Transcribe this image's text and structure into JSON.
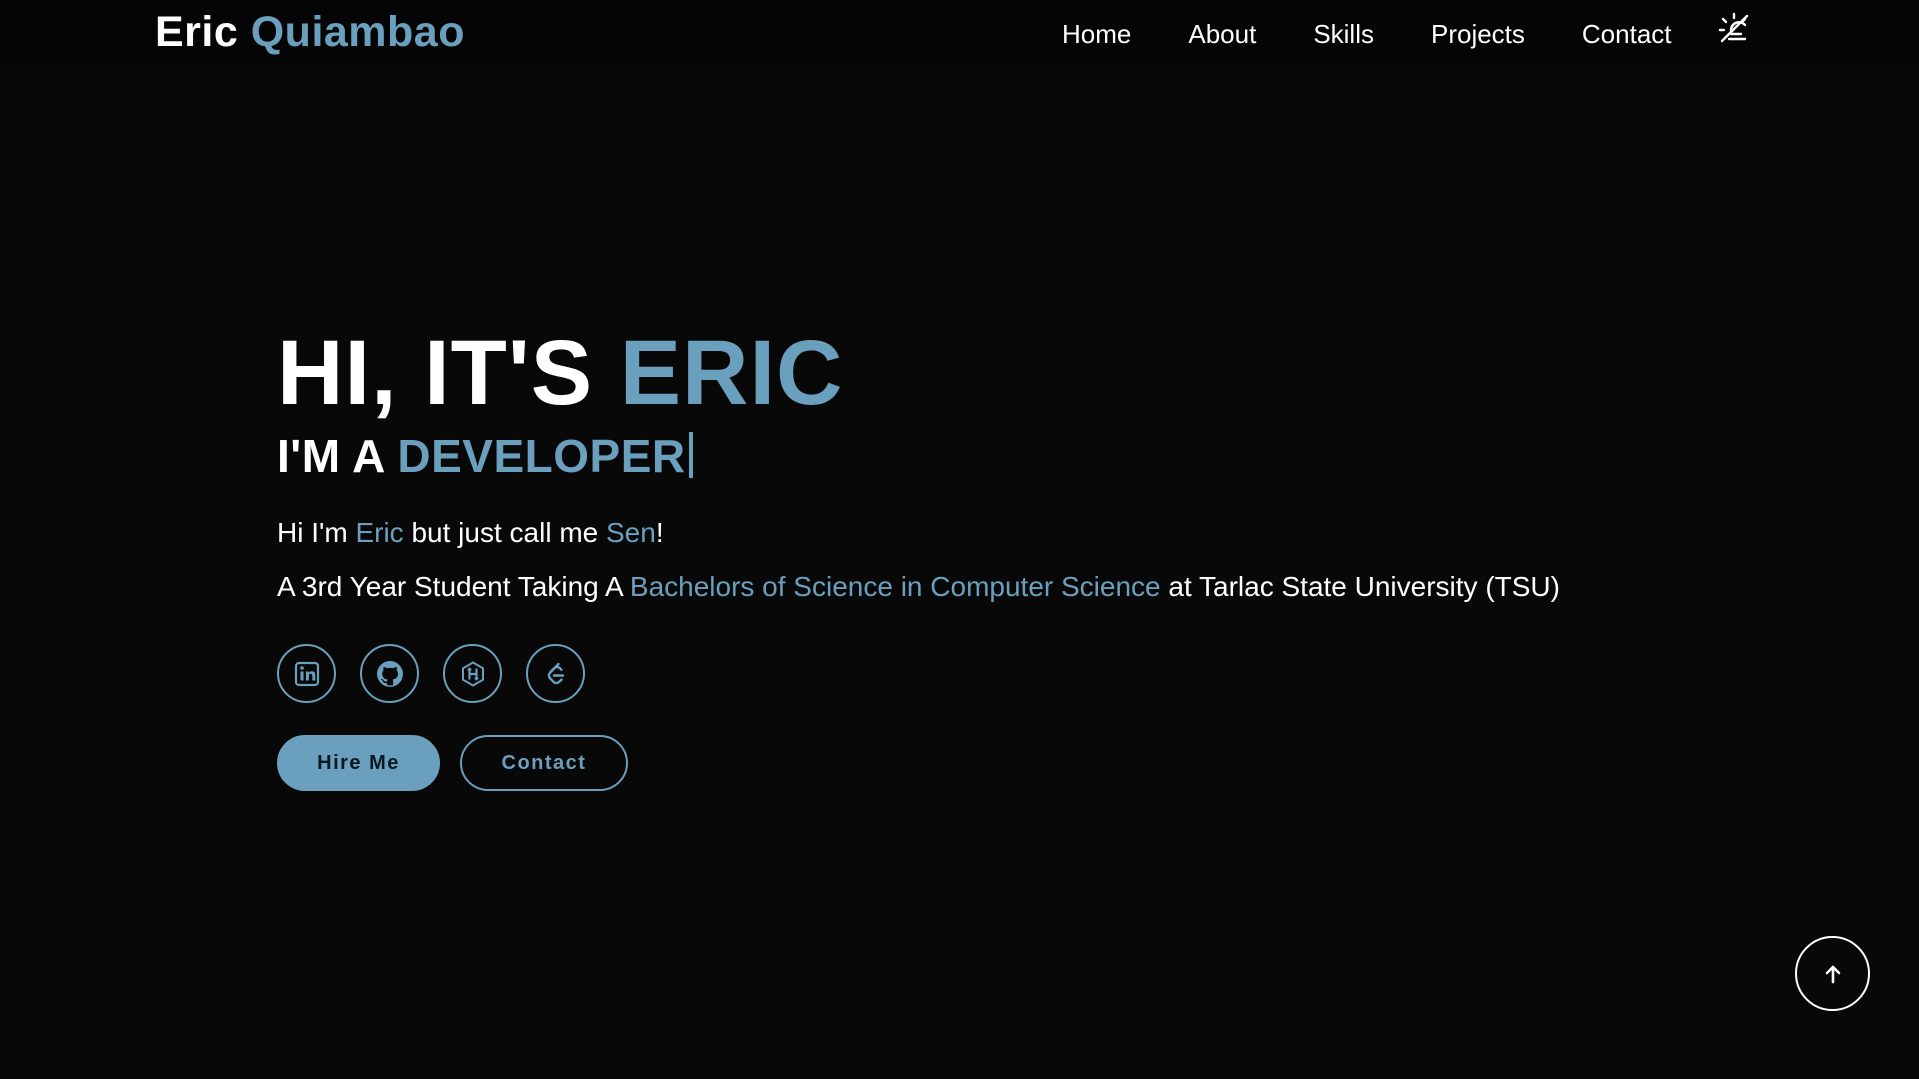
{
  "brand": {
    "first": "Eric",
    "last": "Quiambao"
  },
  "nav": {
    "items": [
      "Home",
      "About",
      "Skills",
      "Projects",
      "Contact"
    ],
    "theme_toggle_icon": "theme-toggle-icon"
  },
  "hero": {
    "title_prefix": "HI, IT'S",
    "title_accent": "ERIC",
    "subtitle_prefix": "I'M A",
    "subtitle_accent": "DEVELOPER",
    "intro1": {
      "a": "Hi I'm",
      "b": "Eric",
      "c": "but just call me",
      "d": "Sen",
      "e": "!"
    },
    "intro2": {
      "a": "A 3rd Year Student Taking A",
      "b": "Bachelors of Science in Computer Science",
      "c": "at Tarlac State University (TSU)"
    }
  },
  "socials": [
    {
      "icon": "linkedin-icon"
    },
    {
      "icon": "github-icon"
    },
    {
      "icon": "hackerrank-icon"
    },
    {
      "icon": "leetcode-icon"
    }
  ],
  "buttons": {
    "hire": "Hire Me",
    "contact": "Contact"
  },
  "colors": {
    "accent": "#6a9fbd",
    "background": "#080808",
    "text": "#ffffff"
  },
  "scroll_top": {
    "icon": "arrow-up-icon"
  }
}
